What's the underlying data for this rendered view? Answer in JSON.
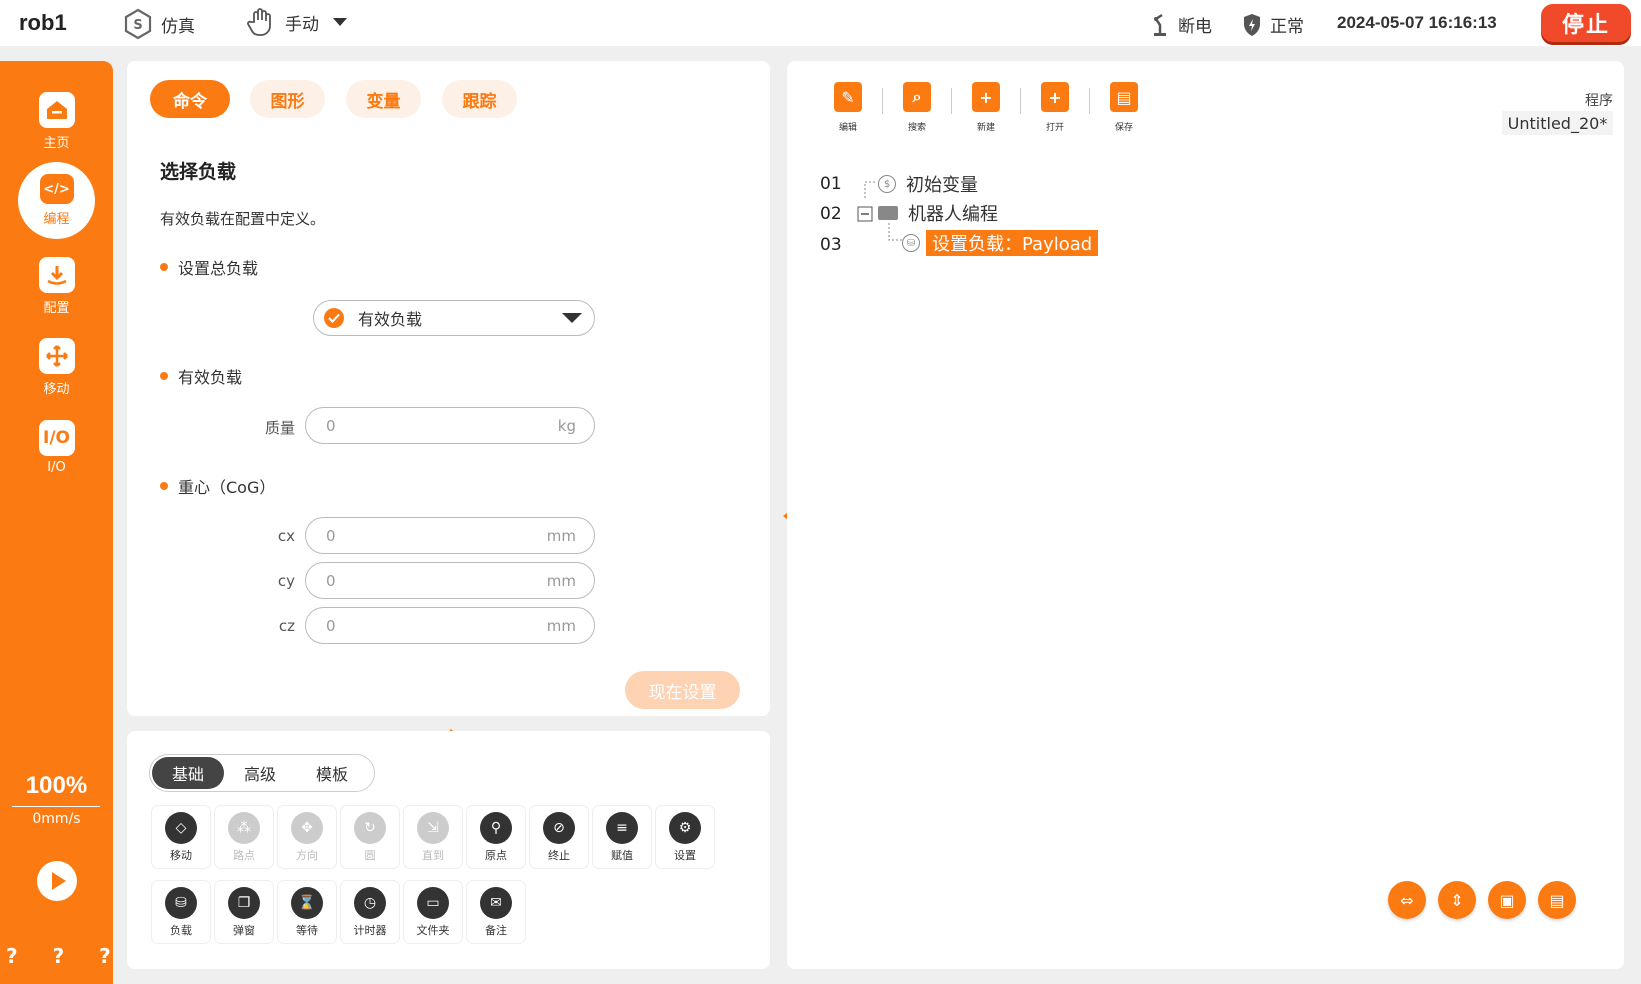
{
  "topbar": {
    "robot": "rob1",
    "mode_sim": "仿真",
    "mode_manual": "手动",
    "power": "断电",
    "status": "正常",
    "datetime": "2024-05-07 16:16:13",
    "stop": "停止"
  },
  "sidebar": {
    "items": [
      {
        "label": "主页",
        "icon": "home-icon"
      },
      {
        "label": "编程",
        "icon": "code-icon"
      },
      {
        "label": "配置",
        "icon": "download-icon"
      },
      {
        "label": "移动",
        "icon": "move-icon"
      },
      {
        "label": "I/O",
        "icon": "io-icon"
      }
    ],
    "active": "编程",
    "speed_pct": "100%",
    "speed_val": "0mm/s",
    "help": "? ? ? ?"
  },
  "cmd": {
    "tabs": [
      "命令",
      "图形",
      "变量",
      "跟踪"
    ],
    "title": "选择负载",
    "desc": "有效负载在配置中定义。",
    "sec_total": "设置总负载",
    "select_value": "有效负载",
    "sec_payload": "有效负载",
    "mass_label": "质量",
    "mass_value": "0",
    "mass_unit": "kg",
    "sec_cog": "重心（CoG）",
    "cx_label": "cx",
    "cx_value": "0",
    "cy_label": "cy",
    "cy_value": "0",
    "cz_label": "cz",
    "cz_value": "0",
    "len_unit": "mm",
    "apply": "现在设置"
  },
  "lib": {
    "segments": [
      "基础",
      "高级",
      "模板"
    ],
    "row1": [
      {
        "label": "移动",
        "icon": "move-cmd-icon",
        "disabled": false
      },
      {
        "label": "路点",
        "icon": "waypoint-icon",
        "disabled": true
      },
      {
        "label": "方向",
        "icon": "direction-icon",
        "disabled": true
      },
      {
        "label": "圆",
        "icon": "circle-icon",
        "disabled": true
      },
      {
        "label": "直到",
        "icon": "until-icon",
        "disabled": true
      },
      {
        "label": "原点",
        "icon": "origin-icon",
        "disabled": false
      },
      {
        "label": "终止",
        "icon": "stop-icon",
        "disabled": false
      },
      {
        "label": "赋值",
        "icon": "assign-icon",
        "disabled": false
      },
      {
        "label": "设置",
        "icon": "settings-icon",
        "disabled": false
      }
    ],
    "row2": [
      {
        "label": "负载",
        "icon": "payload-icon",
        "disabled": false
      },
      {
        "label": "弹窗",
        "icon": "popup-icon",
        "disabled": false
      },
      {
        "label": "等待",
        "icon": "hourglass-icon",
        "disabled": false
      },
      {
        "label": "计时器",
        "icon": "timer-icon",
        "disabled": false
      },
      {
        "label": "文件夹",
        "icon": "folder-icon",
        "disabled": false
      },
      {
        "label": "备注",
        "icon": "comment-icon",
        "disabled": false
      }
    ]
  },
  "prog": {
    "tools": [
      "编辑",
      "搜索",
      "新建",
      "打开",
      "保存"
    ],
    "label": "程序",
    "name": "Untitled_20*",
    "lines": [
      {
        "no": "01",
        "text": "初始变量"
      },
      {
        "no": "02",
        "text": "机器人编程"
      },
      {
        "no": "03",
        "text": "设置负载：Payload"
      }
    ]
  },
  "colors": {
    "accent": "#fb7a12",
    "stop": "#f04a2a"
  }
}
